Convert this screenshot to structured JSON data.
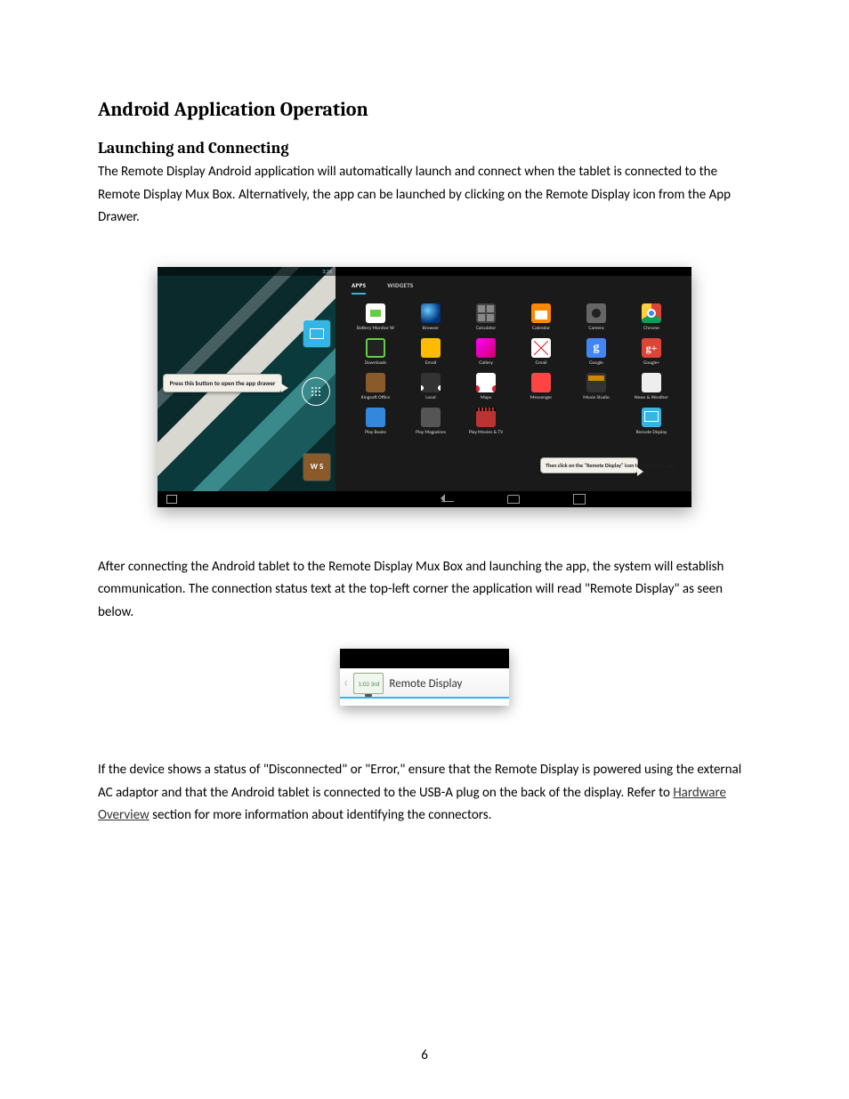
{
  "headings": {
    "h1": "Android Application Operation",
    "h2": "Launching and Connecting"
  },
  "paragraphs": {
    "p1": "The Remote Display Android application will automatically launch and connect when the tablet is connected to the Remote Display Mux Box. Alternatively, the app can be launched by clicking on the Remote Display icon from the App Drawer.",
    "p2": "After connecting the Android tablet to the Remote Display Mux Box and launching the app, the system will establish communication.  The connection status text at the top-left corner the application will read \"Remote Display\" as seen below.",
    "p3a": "If the device shows a status of \"Disconnected\" or \"Error,\" ensure that the Remote Display is powered using the external AC adaptor and that the Android tablet is connected to the USB-A plug on the back of the display. Refer to ",
    "p3link": "Hardware Overview",
    "p3b": " section for more information about identifying the connectors."
  },
  "page_number": "6",
  "fig1": {
    "left_status_time": "3:26",
    "callout_left": "Press this button to open the app drawer",
    "callout_right": "Then click on the \"Remote Display\" icon to launch the app",
    "tabs": {
      "apps": "APPS",
      "widgets": "WIDGETS"
    },
    "dock_ws": "W S",
    "apps": [
      {
        "label": "Battery Monitor W",
        "cls": "ic-batt"
      },
      {
        "label": "Browser",
        "cls": "ic-browser"
      },
      {
        "label": "Calculator",
        "cls": "ic-calc"
      },
      {
        "label": "Calendar",
        "cls": "ic-cal"
      },
      {
        "label": "Camera",
        "cls": "ic-cam"
      },
      {
        "label": "Chrome",
        "cls": "ic-chrome"
      },
      {
        "label": "Downloads",
        "cls": "ic-dl"
      },
      {
        "label": "Email",
        "cls": "ic-email"
      },
      {
        "label": "Gallery",
        "cls": "ic-gallery"
      },
      {
        "label": "Gmail",
        "cls": "ic-gmail"
      },
      {
        "label": "Google",
        "cls": "ic-google",
        "txt": "g"
      },
      {
        "label": "Google+",
        "cls": "ic-gplus",
        "txt": "g+"
      },
      {
        "label": "Kingsoft Office",
        "cls": "ic-ksoft"
      },
      {
        "label": "Local",
        "cls": "ic-local"
      },
      {
        "label": "Maps",
        "cls": "ic-maps"
      },
      {
        "label": "Messenger",
        "cls": "ic-msgr"
      },
      {
        "label": "Movie Studio",
        "cls": "ic-movie"
      },
      {
        "label": "News & Weather",
        "cls": "ic-news"
      },
      {
        "label": "Play Books",
        "cls": "ic-books"
      },
      {
        "label": "Play Magazines",
        "cls": "ic-mags"
      },
      {
        "label": "Play Movies & TV",
        "cls": "ic-movtv"
      },
      {
        "label": "",
        "cls": ""
      },
      {
        "label": "",
        "cls": ""
      },
      {
        "label": "Remote Display",
        "cls": "ic-rd"
      }
    ]
  },
  "fig2": {
    "icon_text": "1:02 3rd",
    "label": "Remote Display"
  }
}
